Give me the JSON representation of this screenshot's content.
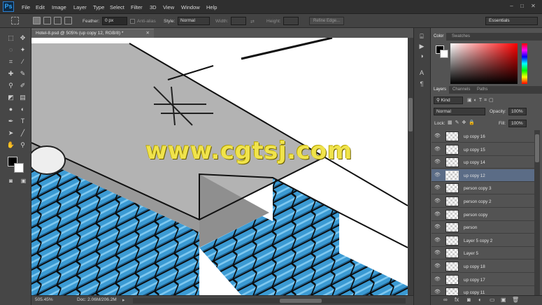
{
  "app": {
    "logo": "Ps"
  },
  "menu": [
    "File",
    "Edit",
    "Image",
    "Layer",
    "Type",
    "Select",
    "Filter",
    "3D",
    "View",
    "Window",
    "Help"
  ],
  "window_controls": {
    "minimize": "–",
    "maximize": "□",
    "close": "✕"
  },
  "options": {
    "feather_label": "Feather:",
    "feather_value": "0 px",
    "antialias_label": "Anti-alias",
    "style_label": "Style:",
    "style_value": "Normal",
    "width_label": "Width:",
    "height_label": "Height:",
    "refine_edge": "Refine Edge...",
    "workspace": "Essentials"
  },
  "document": {
    "tab_title": "Hotel-8.psd @ 505% (up copy 12, RGB/8) *",
    "tab_close": "✕",
    "zoom": "505.45%",
    "doc_info": "Doc: 2.06M/206.2M"
  },
  "watermark": "www.cgtsj.com",
  "colors": {
    "pixel_blue": "#3b9ad3",
    "pixel_light_blue": "#7ec8f0",
    "roof_gray": "#b3b3b3",
    "roof_dark": "#999999",
    "selected_layer": "#5b6c86",
    "watermark": "#f0e34b"
  },
  "color_panel": {
    "tabs": [
      "Color",
      "Swatches"
    ],
    "active": "Color"
  },
  "layers_panel": {
    "tabs": [
      "Layers",
      "Channels",
      "Paths"
    ],
    "active": "Layers",
    "filter_kind": "Kind",
    "blend_mode": "Normal",
    "opacity_label": "Opacity:",
    "opacity_value": "100%",
    "lock_label": "Lock:",
    "fill_label": "Fill:",
    "fill_value": "100%",
    "layers": [
      {
        "name": "up copy 16",
        "selected": false
      },
      {
        "name": "up copy 15",
        "selected": false
      },
      {
        "name": "up copy 14",
        "selected": false
      },
      {
        "name": "up copy 12",
        "selected": true
      },
      {
        "name": "person copy 3",
        "selected": false
      },
      {
        "name": "person copy 2",
        "selected": false
      },
      {
        "name": "person copy",
        "selected": false
      },
      {
        "name": "person",
        "selected": false
      },
      {
        "name": "Layer 5 copy 2",
        "selected": false
      },
      {
        "name": "Layer 5",
        "selected": false
      },
      {
        "name": "up copy 18",
        "selected": false
      },
      {
        "name": "up copy 17",
        "selected": false
      },
      {
        "name": "up copy 11",
        "selected": false
      }
    ]
  },
  "tools": [
    {
      "icon": "marquee-icon",
      "glyph": "⬚"
    },
    {
      "icon": "move-icon",
      "glyph": "✥"
    },
    {
      "icon": "lasso-icon",
      "glyph": "◌"
    },
    {
      "icon": "magic-wand-icon",
      "glyph": "✦"
    },
    {
      "icon": "crop-icon",
      "glyph": "⌗"
    },
    {
      "icon": "eyedropper-icon",
      "glyph": "⁄"
    },
    {
      "icon": "healing-icon",
      "glyph": "✚"
    },
    {
      "icon": "brush-icon",
      "glyph": "✎"
    },
    {
      "icon": "clone-stamp-icon",
      "glyph": "⚲"
    },
    {
      "icon": "history-brush-icon",
      "glyph": "✐"
    },
    {
      "icon": "eraser-icon",
      "glyph": "◩"
    },
    {
      "icon": "gradient-icon",
      "glyph": "▤"
    },
    {
      "icon": "blur-icon",
      "glyph": "●"
    },
    {
      "icon": "dodge-icon",
      "glyph": "◐"
    },
    {
      "icon": "pen-icon",
      "glyph": "✒"
    },
    {
      "icon": "type-icon",
      "glyph": "T"
    },
    {
      "icon": "path-select-icon",
      "glyph": "➤"
    },
    {
      "icon": "line-icon",
      "glyph": "╱"
    },
    {
      "icon": "hand-icon",
      "glyph": "✋"
    },
    {
      "icon": "zoom-icon",
      "glyph": "⚲"
    }
  ]
}
